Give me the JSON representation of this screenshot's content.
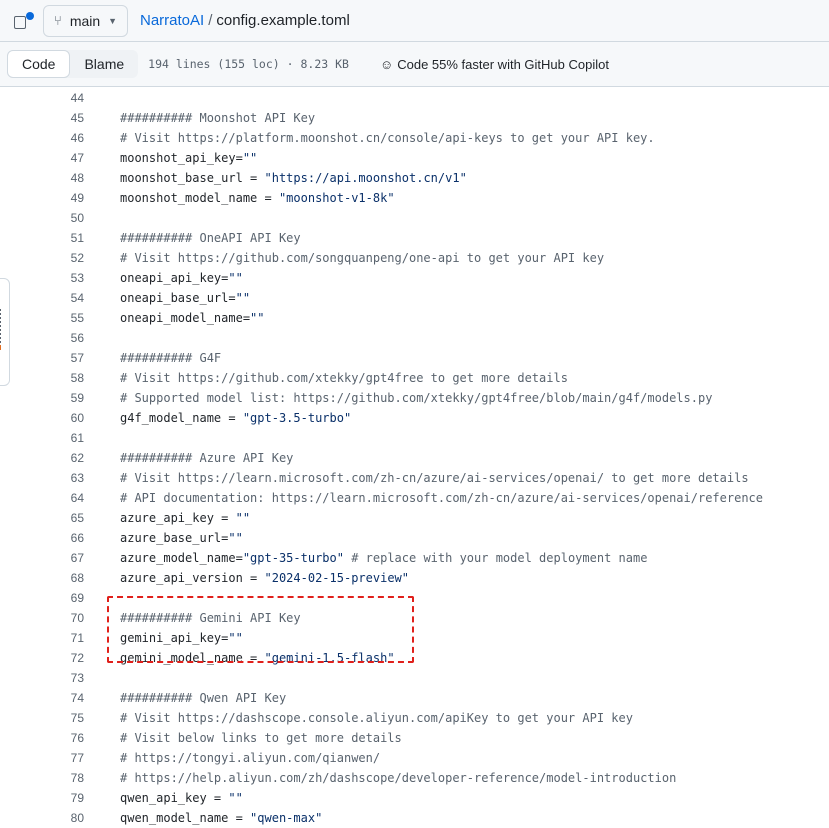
{
  "header": {
    "branch": "main",
    "repo": "NarratoAI",
    "separator": "/",
    "file": "config.example.toml"
  },
  "toolbar": {
    "code_label": "Code",
    "blame_label": "Blame",
    "meta": "194 lines (155 loc) · 8.23 KB",
    "copilot": "Code 55% faster with GitHub Copilot"
  },
  "icons": {
    "sidebar": "sidebar-toggle-icon",
    "branch": "git-branch-icon",
    "copilot": "copilot-icon"
  },
  "highlight_color": "#e0201b",
  "lines": [
    {
      "n": "44",
      "parts": []
    },
    {
      "n": "45",
      "parts": [
        [
          "########## Moonshot API Key",
          "c"
        ]
      ]
    },
    {
      "n": "46",
      "parts": [
        [
          "# Visit https://platform.moonshot.cn/console/api-keys to get your API key.",
          "c"
        ]
      ]
    },
    {
      "n": "47",
      "parts": [
        [
          "moonshot_api_key=",
          ""
        ],
        [
          "\"\"",
          "s"
        ]
      ]
    },
    {
      "n": "48",
      "parts": [
        [
          "moonshot_base_url = ",
          ""
        ],
        [
          "\"https://api.moonshot.cn/v1\"",
          "s"
        ]
      ]
    },
    {
      "n": "49",
      "parts": [
        [
          "moonshot_model_name = ",
          ""
        ],
        [
          "\"moonshot-v1-8k\"",
          "s"
        ]
      ]
    },
    {
      "n": "50",
      "parts": []
    },
    {
      "n": "51",
      "parts": [
        [
          "########## OneAPI API Key",
          "c"
        ]
      ]
    },
    {
      "n": "52",
      "parts": [
        [
          "# Visit https://github.com/songquanpeng/one-api to get your API key",
          "c"
        ]
      ]
    },
    {
      "n": "53",
      "parts": [
        [
          "oneapi_api_key=",
          ""
        ],
        [
          "\"\"",
          "s"
        ]
      ]
    },
    {
      "n": "54",
      "parts": [
        [
          "oneapi_base_url=",
          ""
        ],
        [
          "\"\"",
          "s"
        ]
      ]
    },
    {
      "n": "55",
      "parts": [
        [
          "oneapi_model_name=",
          ""
        ],
        [
          "\"\"",
          "s"
        ]
      ]
    },
    {
      "n": "56",
      "parts": []
    },
    {
      "n": "57",
      "parts": [
        [
          "########## G4F",
          "c"
        ]
      ]
    },
    {
      "n": "58",
      "parts": [
        [
          "# Visit https://github.com/xtekky/gpt4free to get more details",
          "c"
        ]
      ]
    },
    {
      "n": "59",
      "parts": [
        [
          "# Supported model list: https://github.com/xtekky/gpt4free/blob/main/g4f/models.py",
          "c"
        ]
      ]
    },
    {
      "n": "60",
      "parts": [
        [
          "g4f_model_name = ",
          ""
        ],
        [
          "\"gpt-3.5-turbo\"",
          "s"
        ]
      ]
    },
    {
      "n": "61",
      "parts": []
    },
    {
      "n": "62",
      "parts": [
        [
          "########## Azure API Key",
          "c"
        ]
      ]
    },
    {
      "n": "63",
      "parts": [
        [
          "# Visit https://learn.microsoft.com/zh-cn/azure/ai-services/openai/ to get more details",
          "c"
        ]
      ]
    },
    {
      "n": "64",
      "parts": [
        [
          "# API documentation: https://learn.microsoft.com/zh-cn/azure/ai-services/openai/reference",
          "c"
        ]
      ]
    },
    {
      "n": "65",
      "parts": [
        [
          "azure_api_key = ",
          ""
        ],
        [
          "\"\"",
          "s"
        ]
      ]
    },
    {
      "n": "66",
      "parts": [
        [
          "azure_base_url=",
          ""
        ],
        [
          "\"\"",
          "s"
        ]
      ]
    },
    {
      "n": "67",
      "parts": [
        [
          "azure_model_name=",
          ""
        ],
        [
          "\"gpt-35-turbo\"",
          "s"
        ],
        [
          " # replace with your model deployment name",
          "c"
        ]
      ]
    },
    {
      "n": "68",
      "parts": [
        [
          "azure_api_version = ",
          ""
        ],
        [
          "\"2024-02-15-preview\"",
          "s"
        ]
      ]
    },
    {
      "n": "69",
      "parts": []
    },
    {
      "n": "70",
      "parts": [
        [
          "########## Gemini API Key",
          "c"
        ]
      ]
    },
    {
      "n": "71",
      "parts": [
        [
          "gemini_api_key=",
          ""
        ],
        [
          "\"\"",
          "s"
        ]
      ]
    },
    {
      "n": "72",
      "parts": [
        [
          "gemini_model_name = ",
          ""
        ],
        [
          "\"gemini-1.5-flash\"",
          "s"
        ]
      ]
    },
    {
      "n": "73",
      "parts": []
    },
    {
      "n": "74",
      "parts": [
        [
          "########## Qwen API Key",
          "c"
        ]
      ]
    },
    {
      "n": "75",
      "parts": [
        [
          "# Visit https://dashscope.console.aliyun.com/apiKey to get your API key",
          "c"
        ]
      ]
    },
    {
      "n": "76",
      "parts": [
        [
          "# Visit below links to get more details",
          "c"
        ]
      ]
    },
    {
      "n": "77",
      "parts": [
        [
          "# https://tongyi.aliyun.com/qianwen/",
          "c"
        ]
      ]
    },
    {
      "n": "78",
      "parts": [
        [
          "# https://help.aliyun.com/zh/dashscope/developer-reference/model-introduction",
          "c"
        ]
      ]
    },
    {
      "n": "79",
      "parts": [
        [
          "qwen_api_key = ",
          ""
        ],
        [
          "\"\"",
          "s"
        ]
      ]
    },
    {
      "n": "80",
      "parts": [
        [
          "qwen_model_name = ",
          ""
        ],
        [
          "\"qwen-max\"",
          "s"
        ]
      ]
    }
  ]
}
